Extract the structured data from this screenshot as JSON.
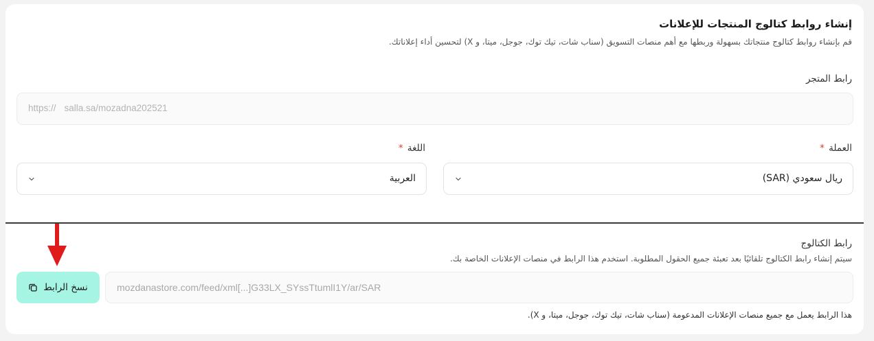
{
  "section": {
    "title": "إنشاء روابط كتالوج المنتجات للإعلانات",
    "description": "قم بإنشاء روابط كتالوج منتجاتك بسهولة وربطها مع أهم منصات التسويق (سناب شات، تيك توك، جوجل، ميتا، و X) لتحسين أداء إعلاناتك."
  },
  "store_link": {
    "label": "رابط المتجر",
    "prefix": "https://",
    "value": "salla.sa/mozadna202521"
  },
  "currency": {
    "label": "العملة",
    "required_mark": "*",
    "value": "ريال سعودي (SAR)"
  },
  "language": {
    "label": "اللغة",
    "required_mark": "*",
    "value": "العربية"
  },
  "catalog": {
    "label": "رابط الكتالوج",
    "hint": "سيتم إنشاء رابط الكتالوج تلقائيًا بعد تعبئة جميع الحقول المطلوبة. استخدم هذا الرابط في منصات الإعلانات الخاصة بك.",
    "value": "mozdanastore.com/feed/xml[...]G33LX_SYssTtumlI1Y/ar/SAR",
    "copy_label": "نسخ الرابط",
    "note": "هذا الرابط يعمل مع جميع منصات الإعلانات المدعومة (سناب شات، تيك توك، جوجل، ميتا، و X)."
  },
  "colors": {
    "copy_button_bg": "#a6f5e4",
    "annotation_arrow": "#e01b1b",
    "required_mark": "#e53935"
  },
  "icons": {
    "copy": "copy-icon",
    "chevron": "chevron-down-icon",
    "arrow": "arrow-down-annotation"
  }
}
